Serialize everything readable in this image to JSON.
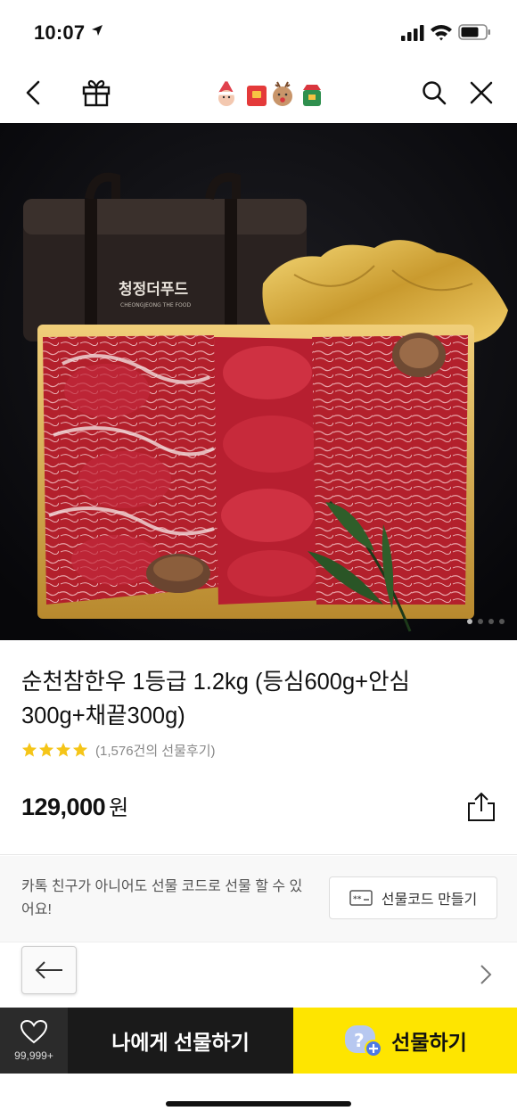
{
  "status_bar": {
    "time": "10:07"
  },
  "nav": {
    "back_icon": "chevron-left-icon",
    "gift_icon": "gift-box-icon",
    "stickers": [
      "santa-sticker",
      "red-envelope-sticker",
      "reindeer-sticker",
      "christmas-sticker"
    ],
    "search_icon": "search-icon",
    "close_icon": "close-icon"
  },
  "hero": {
    "bag_logo": "청정더푸드",
    "bag_logo_sub": "CHEONGJEONG THE FOOD",
    "page_indicator": {
      "total": 4,
      "active": 1
    }
  },
  "product": {
    "title": "순천참한우 1등급 1.2kg (등심600g+안심300g+채끝300g)",
    "rating_stars": 4,
    "review_count": "(1,576건의 선물후기)",
    "price": "129,000",
    "price_unit": "원"
  },
  "gift_code": {
    "description": "카톡 친구가 아니어도 선물 코드로 선물 할 수 있어요!",
    "button_label": "선물코드 만들기"
  },
  "bottom_bar": {
    "wish_count": "99,999+",
    "self_gift_label": "나에게 선물하기",
    "gift_label": "선물하기"
  },
  "colors": {
    "accent_yellow": "#FEE500",
    "dark_button": "#1A1A1A",
    "star": "#F5C518"
  }
}
